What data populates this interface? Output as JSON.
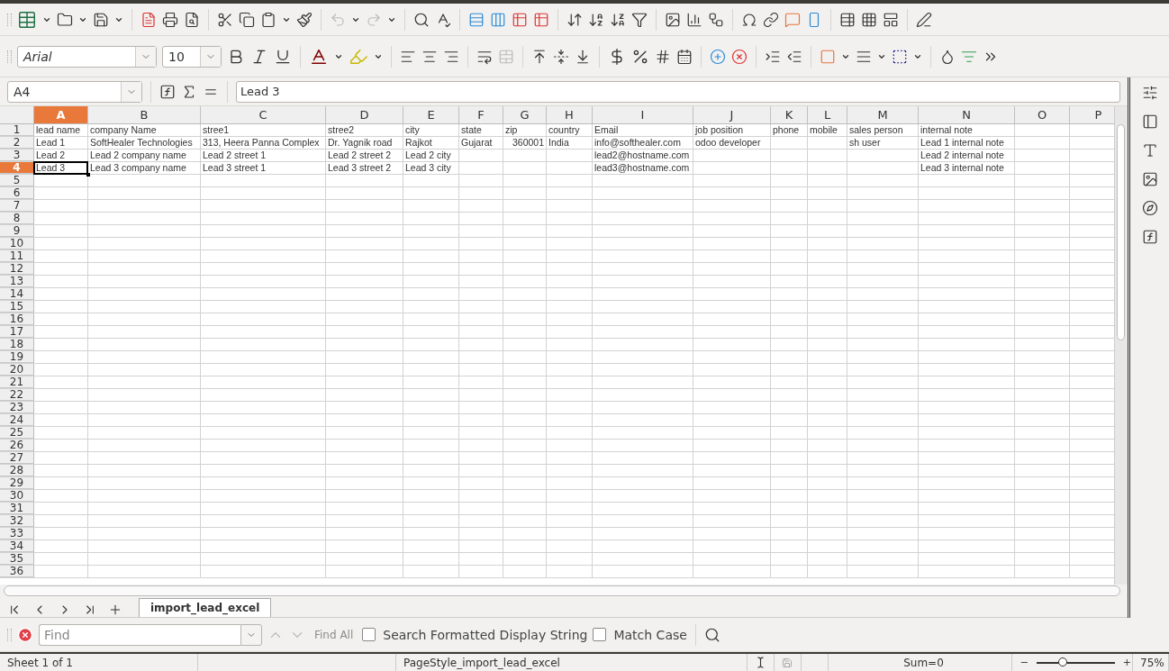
{
  "toolbar_format": {
    "font_name": "Arial",
    "font_size": "10"
  },
  "formula_bar": {
    "cell_ref": "A4",
    "content": "Lead 3"
  },
  "columns": [
    {
      "label": "A",
      "selected": true
    },
    {
      "label": "B",
      "selected": false
    },
    {
      "label": "C",
      "selected": false
    },
    {
      "label": "D",
      "selected": false
    },
    {
      "label": "E",
      "selected": false
    },
    {
      "label": "F",
      "selected": false
    },
    {
      "label": "G",
      "selected": false
    },
    {
      "label": "H",
      "selected": false
    },
    {
      "label": "I",
      "selected": false
    },
    {
      "label": "J",
      "selected": false
    },
    {
      "label": "K",
      "selected": false
    },
    {
      "label": "L",
      "selected": false
    },
    {
      "label": "M",
      "selected": false
    },
    {
      "label": "N",
      "selected": false
    },
    {
      "label": "O",
      "selected": false
    },
    {
      "label": "P",
      "selected": false
    }
  ],
  "rows": [
    {
      "number": "1",
      "selected": false,
      "cells": [
        "lead name",
        "company Name",
        "stree1",
        "stree2",
        "city",
        "state",
        "zip",
        "country",
        "Email",
        "job position",
        "phone",
        "mobile",
        "sales person",
        "internal note"
      ]
    },
    {
      "number": "2",
      "selected": false,
      "cells": [
        "Lead 1",
        "SoftHealer Technologies",
        "313, Heera Panna Complex",
        "Dr. Yagnik road",
        "Rajkot",
        "Gujarat",
        {
          "text": "360001",
          "kind": "number"
        },
        "India",
        "info@softhealer.com",
        "odoo developer",
        null,
        null,
        "sh user",
        "Lead 1 internal note"
      ]
    },
    {
      "number": "3",
      "selected": false,
      "cells": [
        "Lead 2",
        "Lead 2 company name",
        "Lead 2 street 1",
        "Lead 2 street 2",
        "Lead 2 city",
        null,
        null,
        null,
        "lead2@hostname.com",
        null,
        null,
        null,
        null,
        "Lead 2 internal note"
      ]
    },
    {
      "number": "4",
      "selected": true,
      "cells": [
        "Lead 3",
        "Lead 3 company name",
        "Lead 3 street 1",
        "Lead 3 street 2",
        "Lead 3 city",
        null,
        null,
        null,
        "lead3@hostname.com",
        null,
        null,
        null,
        null,
        "Lead 3 internal note"
      ]
    },
    {
      "number": "5",
      "selected": false
    },
    {
      "number": "6",
      "selected": false
    },
    {
      "number": "7",
      "selected": false
    },
    {
      "number": "8",
      "selected": false
    },
    {
      "number": "9",
      "selected": false
    },
    {
      "number": "10",
      "selected": false
    },
    {
      "number": "11",
      "selected": false
    },
    {
      "number": "12",
      "selected": false
    },
    {
      "number": "13",
      "selected": false
    },
    {
      "number": "14",
      "selected": false
    },
    {
      "number": "15",
      "selected": false
    },
    {
      "number": "16",
      "selected": false
    },
    {
      "number": "17",
      "selected": false
    },
    {
      "number": "18",
      "selected": false
    },
    {
      "number": "19",
      "selected": false
    },
    {
      "number": "20",
      "selected": false
    },
    {
      "number": "21",
      "selected": false
    },
    {
      "number": "22",
      "selected": false
    },
    {
      "number": "23",
      "selected": false
    },
    {
      "number": "24",
      "selected": false
    },
    {
      "number": "25",
      "selected": false
    },
    {
      "number": "26",
      "selected": false
    },
    {
      "number": "27",
      "selected": false
    },
    {
      "number": "28",
      "selected": false
    },
    {
      "number": "29",
      "selected": false
    },
    {
      "number": "30",
      "selected": false
    },
    {
      "number": "31",
      "selected": false
    },
    {
      "number": "32",
      "selected": false
    },
    {
      "number": "33",
      "selected": false
    },
    {
      "number": "34",
      "selected": false
    },
    {
      "number": "35",
      "selected": false
    },
    {
      "number": "36",
      "selected": false
    }
  ],
  "sheet_tabs": [
    {
      "label": "import_lead_excel",
      "selected": true
    }
  ],
  "find_bar": {
    "placeholder": "Find",
    "find_all": {
      "label": "Find All",
      "disabled": true
    },
    "options": [
      {
        "label": "Search Formatted Display String",
        "checked": false
      },
      {
        "label": "Match Case",
        "checked": false
      }
    ]
  },
  "status_bar": {
    "sheet": "Sheet 1 of 1",
    "page_style": "PageStyle_import_lead_excel",
    "sum": "Sum=0",
    "zoom_slider": {
      "level": 0.33
    },
    "zoom": "75%"
  }
}
